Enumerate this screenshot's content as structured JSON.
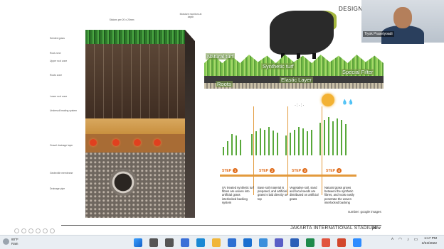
{
  "slide": {
    "title": "DESIGN C",
    "soil_left_labels": [
      "Seeded grass",
      "Root zone",
      "Upper root zone",
      "Roots zone",
      "Lower root zone",
      "Undersoil heating system",
      "Gravel drainage layer",
      "Geotextile membrane",
      "Drainage pipe"
    ],
    "soil_top_labels": [
      "Stolons per 20 x 20mm",
      "Moisture monitors at depth"
    ],
    "turf_labels": {
      "natural": "Natural turf",
      "synthetic": "Synthetic turf",
      "special": "Special Filter",
      "elastic": "Elastic Layer",
      "roots": "Roots"
    },
    "steps": [
      {
        "label": "STEP",
        "num": "1",
        "text": "UV treated synthetic turf fibres are woven into artificial grass interlocked backing system"
      },
      {
        "label": "STEP",
        "num": "2",
        "text": "Base soil material is prepared, and artificial grass is laid directly on top"
      },
      {
        "label": "STEP",
        "num": "3",
        "text": "Vegetative soil, sand and local seeds are distributed on artificial grass"
      },
      {
        "label": "STEP",
        "num": "4",
        "text": "Natural grass grows between the synthetic fibres, and roots easily penetrate the woven interlocked backing"
      }
    ],
    "source": "sumber: google images",
    "footer": "JAKARTA INTERNATIONAL STADIUM",
    "footer_logo": "pdw"
  },
  "webcam": {
    "name": "Tiyok Prasetyoadi"
  },
  "taskbar": {
    "weather_temp": "80°F",
    "weather_desc": "Rain",
    "time": "1:17 PM",
    "date": "3/23/2022",
    "apps": [
      "windows-start-icon",
      "search-icon",
      "task-view-icon",
      "widgets-icon",
      "edge-icon",
      "file-explorer-icon",
      "store-icon",
      "mail-icon",
      "photos-icon",
      "teams-icon",
      "word-icon",
      "excel-icon",
      "chrome-icon",
      "powerpoint-icon",
      "zoom-icon"
    ]
  },
  "colors": {
    "accent": "#e06c1a",
    "grass": "#58a83a"
  }
}
